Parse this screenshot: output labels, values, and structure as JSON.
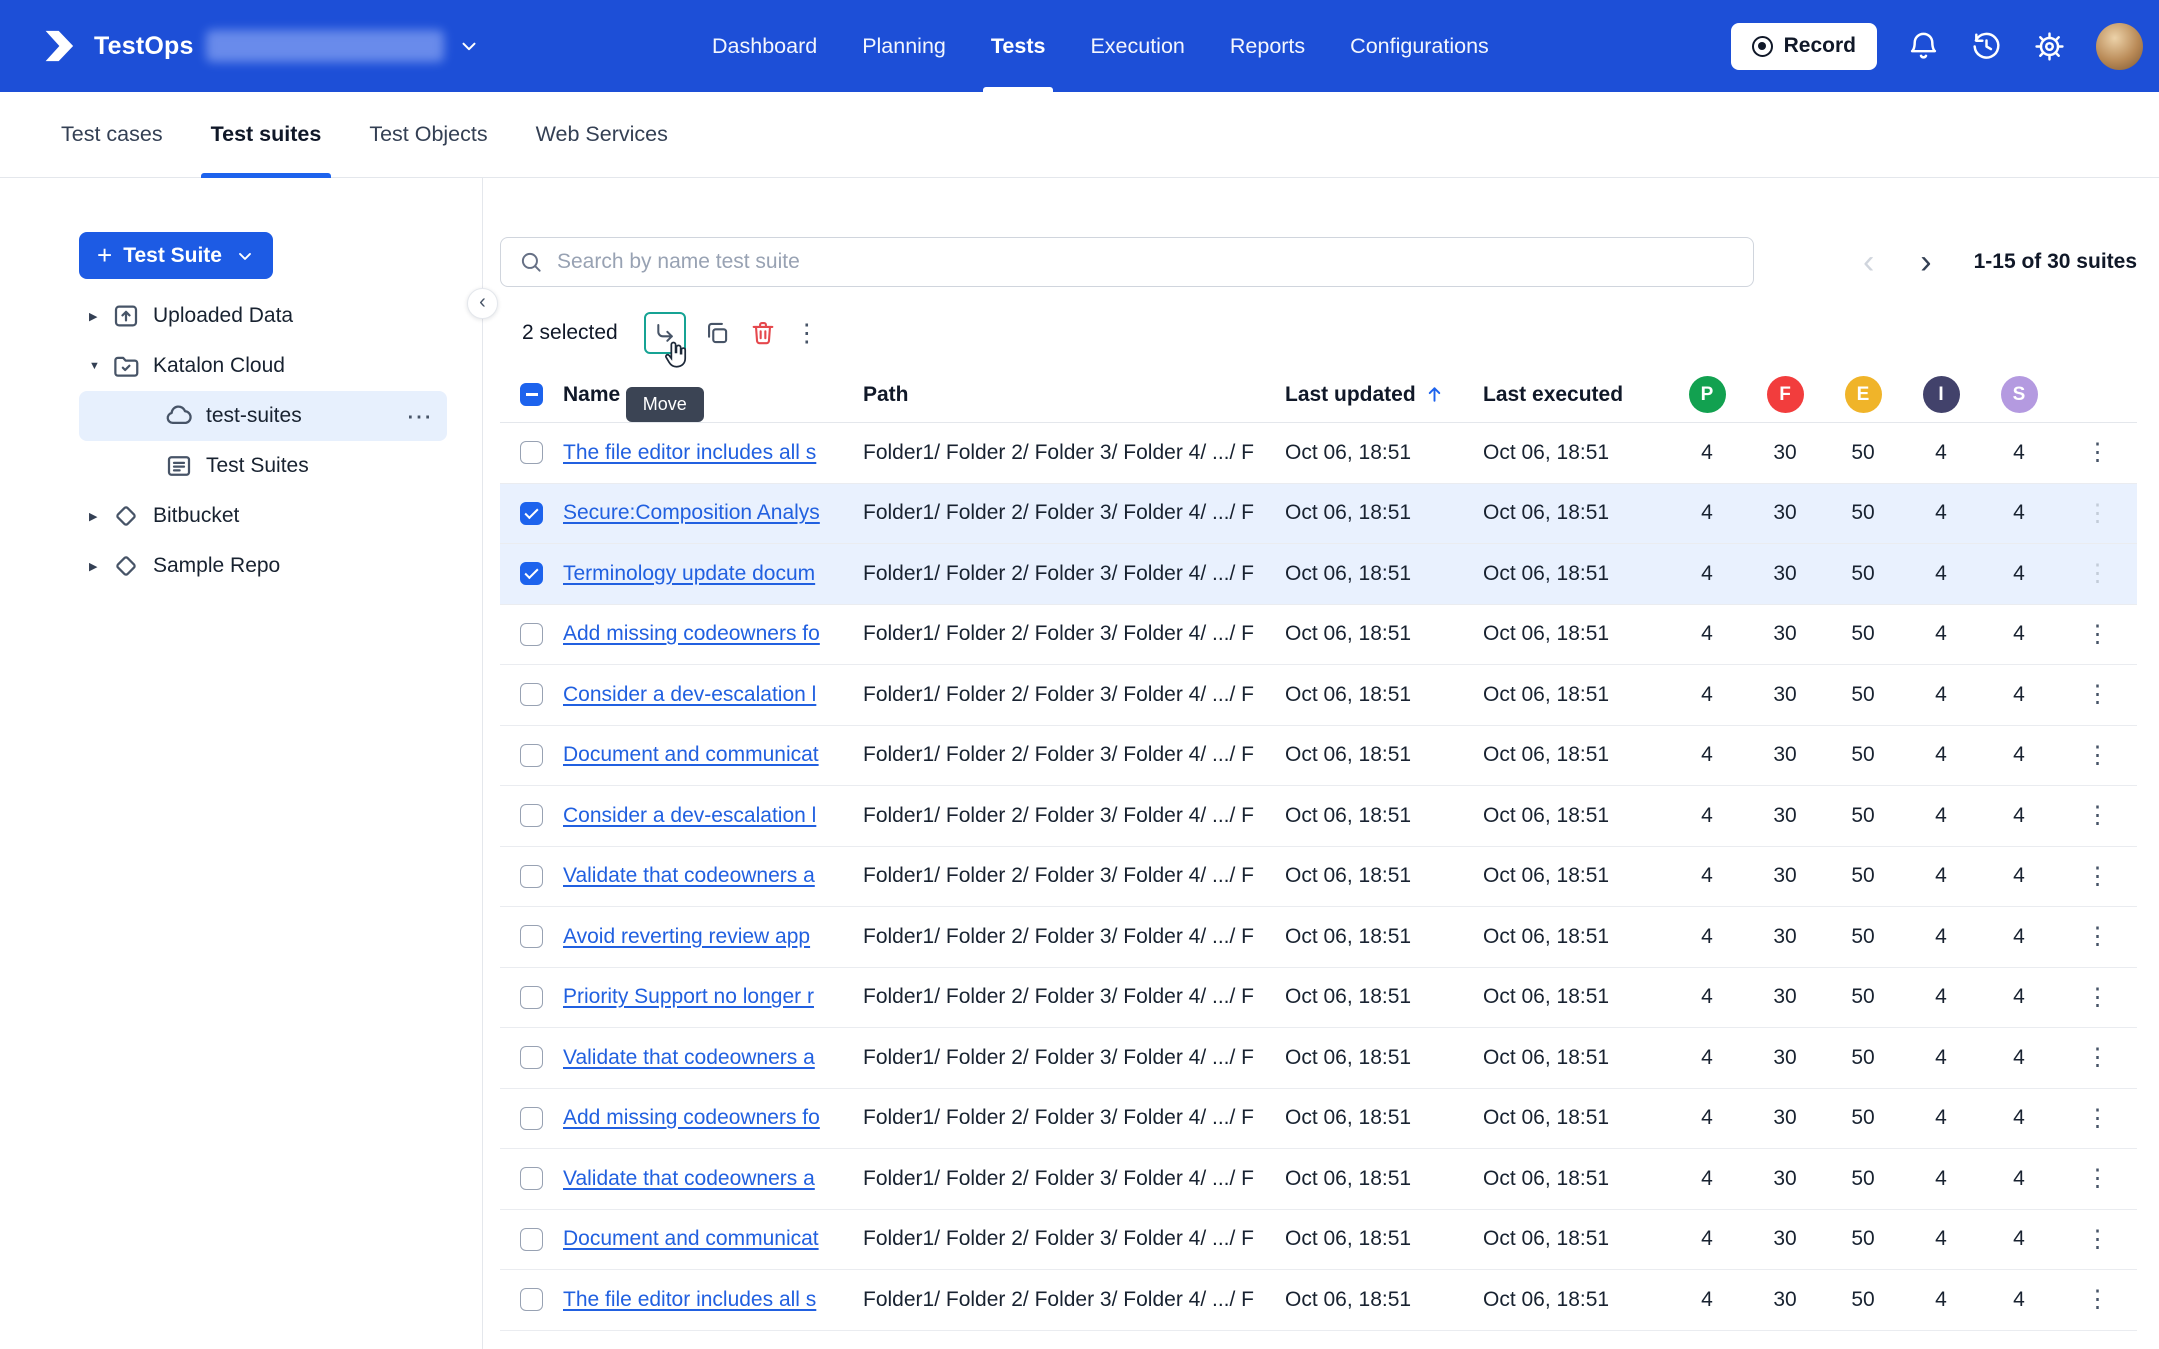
{
  "icons": {
    "plus": "+",
    "caret_right": "▶",
    "caret_down": "▼",
    "more": "⋯",
    "kebab": "⋮",
    "prev": "‹",
    "next": "›",
    "collapse": "‹"
  },
  "topbar": {
    "app_name": "TestOps",
    "nav_items": [
      {
        "label": "Dashboard",
        "active": false
      },
      {
        "label": "Planning",
        "active": false
      },
      {
        "label": "Tests",
        "active": true
      },
      {
        "label": "Execution",
        "active": false
      },
      {
        "label": "Reports",
        "active": false
      },
      {
        "label": "Configurations",
        "active": false
      }
    ],
    "record_button": "Record"
  },
  "tabs": [
    {
      "label": "Test cases",
      "active": false
    },
    {
      "label": "Test suites",
      "active": true
    },
    {
      "label": "Test Objects",
      "active": false
    },
    {
      "label": "Web Services",
      "active": false
    }
  ],
  "sidebar": {
    "new_button_label": "Test Suite",
    "tree": [
      {
        "label": "Uploaded Data",
        "icon": "uploaded-data",
        "caret": "right",
        "level": 0,
        "selected": false
      },
      {
        "label": "Katalon Cloud",
        "icon": "katalon-cloud",
        "caret": "down",
        "level": 0,
        "selected": false
      },
      {
        "label": "test-suites",
        "icon": "cloud",
        "caret": "none",
        "level": 1,
        "selected": true,
        "has_more": true
      },
      {
        "label": "Test Suites",
        "icon": "suite-card",
        "caret": "none",
        "level": 1,
        "selected": false
      },
      {
        "label": "Bitbucket",
        "icon": "repo",
        "caret": "right",
        "level": 0,
        "selected": false
      },
      {
        "label": "Sample Repo",
        "icon": "repo",
        "caret": "right",
        "level": 0,
        "selected": false
      }
    ]
  },
  "toolbar": {
    "search_placeholder": "Search by name test suite",
    "pagination": "1-15 of 30 suites",
    "selected_text": "2 selected",
    "move_tooltip": "Move"
  },
  "table": {
    "columns": {
      "name": "Name",
      "path": "Path",
      "last_updated": "Last updated",
      "last_executed": "Last executed"
    },
    "badge_columns": [
      {
        "letter": "P",
        "color": "#12a150"
      },
      {
        "letter": "F",
        "color": "#f23d3d"
      },
      {
        "letter": "E",
        "color": "#f0b429"
      },
      {
        "letter": "I",
        "color": "#42426b"
      },
      {
        "letter": "S",
        "color": "#b49ae0"
      }
    ],
    "rows": [
      {
        "name": "The file editor includes all s",
        "checked": false,
        "path": "Folder1/ Folder 2/ Folder 3/ Folder 4/ .../ F",
        "last_updated": "Oct 06, 18:51",
        "last_executed": "Oct 06, 18:51",
        "p": "4",
        "f": "30",
        "e": "50",
        "i": "4",
        "s": "4"
      },
      {
        "name": "Secure:Composition Analys",
        "checked": true,
        "path": "Folder1/ Folder 2/ Folder 3/ Folder 4/ .../ F",
        "last_updated": "Oct 06, 18:51",
        "last_executed": "Oct 06, 18:51",
        "p": "4",
        "f": "30",
        "e": "50",
        "i": "4",
        "s": "4"
      },
      {
        "name": "Terminology update docum",
        "checked": true,
        "path": "Folder1/ Folder 2/ Folder 3/ Folder 4/ .../ F",
        "last_updated": "Oct 06, 18:51",
        "last_executed": "Oct 06, 18:51",
        "p": "4",
        "f": "30",
        "e": "50",
        "i": "4",
        "s": "4"
      },
      {
        "name": "Add missing codeowners fo",
        "checked": false,
        "path": "Folder1/ Folder 2/ Folder 3/ Folder 4/ .../ F",
        "last_updated": "Oct 06, 18:51",
        "last_executed": "Oct 06, 18:51",
        "p": "4",
        "f": "30",
        "e": "50",
        "i": "4",
        "s": "4"
      },
      {
        "name": "Consider a dev-escalation l",
        "checked": false,
        "path": "Folder1/ Folder 2/ Folder 3/ Folder 4/ .../ F",
        "last_updated": "Oct 06, 18:51",
        "last_executed": "Oct 06, 18:51",
        "p": "4",
        "f": "30",
        "e": "50",
        "i": "4",
        "s": "4"
      },
      {
        "name": "Document and communicat",
        "checked": false,
        "path": "Folder1/ Folder 2/ Folder 3/ Folder 4/ .../ F",
        "last_updated": "Oct 06, 18:51",
        "last_executed": "Oct 06, 18:51",
        "p": "4",
        "f": "30",
        "e": "50",
        "i": "4",
        "s": "4"
      },
      {
        "name": "Consider a dev-escalation l",
        "checked": false,
        "path": "Folder1/ Folder 2/ Folder 3/ Folder 4/ .../ F",
        "last_updated": "Oct 06, 18:51",
        "last_executed": "Oct 06, 18:51",
        "p": "4",
        "f": "30",
        "e": "50",
        "i": "4",
        "s": "4"
      },
      {
        "name": "Validate that codeowners a",
        "checked": false,
        "path": "Folder1/ Folder 2/ Folder 3/ Folder 4/ .../ F",
        "last_updated": "Oct 06, 18:51",
        "last_executed": "Oct 06, 18:51",
        "p": "4",
        "f": "30",
        "e": "50",
        "i": "4",
        "s": "4"
      },
      {
        "name": "Avoid reverting review app",
        "checked": false,
        "path": "Folder1/ Folder 2/ Folder 3/ Folder 4/ .../ F",
        "last_updated": "Oct 06, 18:51",
        "last_executed": "Oct 06, 18:51",
        "p": "4",
        "f": "30",
        "e": "50",
        "i": "4",
        "s": "4"
      },
      {
        "name": "Priority Support no longer r",
        "checked": false,
        "path": "Folder1/ Folder 2/ Folder 3/ Folder 4/ .../ F",
        "last_updated": "Oct 06, 18:51",
        "last_executed": "Oct 06, 18:51",
        "p": "4",
        "f": "30",
        "e": "50",
        "i": "4",
        "s": "4"
      },
      {
        "name": "Validate that codeowners a",
        "checked": false,
        "path": "Folder1/ Folder 2/ Folder 3/ Folder 4/ .../ F",
        "last_updated": "Oct 06, 18:51",
        "last_executed": "Oct 06, 18:51",
        "p": "4",
        "f": "30",
        "e": "50",
        "i": "4",
        "s": "4"
      },
      {
        "name": "Add missing codeowners fo",
        "checked": false,
        "path": "Folder1/ Folder 2/ Folder 3/ Folder 4/ .../ F",
        "last_updated": "Oct 06, 18:51",
        "last_executed": "Oct 06, 18:51",
        "p": "4",
        "f": "30",
        "e": "50",
        "i": "4",
        "s": "4"
      },
      {
        "name": "Validate that codeowners a",
        "checked": false,
        "path": "Folder1/ Folder 2/ Folder 3/ Folder 4/ .../ F",
        "last_updated": "Oct 06, 18:51",
        "last_executed": "Oct 06, 18:51",
        "p": "4",
        "f": "30",
        "e": "50",
        "i": "4",
        "s": "4"
      },
      {
        "name": "Document and communicat",
        "checked": false,
        "path": "Folder1/ Folder 2/ Folder 3/ Folder 4/ .../ F",
        "last_updated": "Oct 06, 18:51",
        "last_executed": "Oct 06, 18:51",
        "p": "4",
        "f": "30",
        "e": "50",
        "i": "4",
        "s": "4"
      },
      {
        "name": "The file editor includes all s",
        "checked": false,
        "path": "Folder1/ Folder 2/ Folder 3/ Folder 4/ .../ F",
        "last_updated": "Oct 06, 18:51",
        "last_executed": "Oct 06, 18:51",
        "p": "4",
        "f": "30",
        "e": "50",
        "i": "4",
        "s": "4"
      }
    ]
  }
}
